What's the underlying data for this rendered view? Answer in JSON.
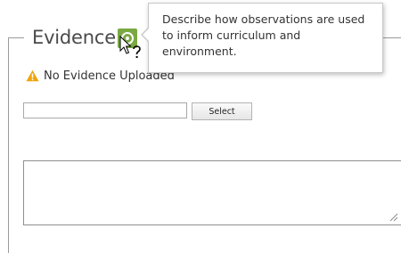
{
  "section": {
    "legend": "Evidence",
    "help_icon": "question-help-icon",
    "accent_color": "#7aa843"
  },
  "tooltip": {
    "text": "Describe how observations are used to inform curriculum and environment."
  },
  "status": {
    "icon": "warning-icon",
    "text": "No Evidence Uploaded",
    "icon_color": "#f0a30a"
  },
  "upload": {
    "file_value": "",
    "select_label": "Select"
  },
  "notes": {
    "value": ""
  }
}
